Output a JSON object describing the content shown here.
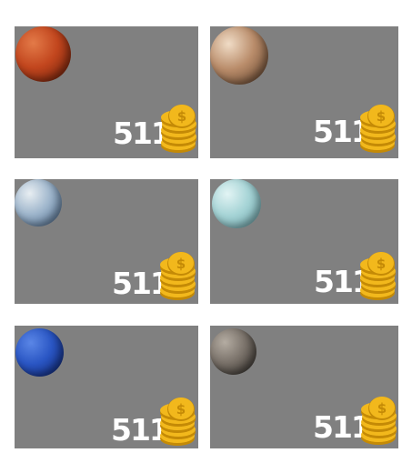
{
  "cards": [
    {
      "planet": "mars-icon",
      "price": "511",
      "colors": {
        "base": "#c2461e",
        "light": "#e37a48",
        "dark": "#6a1e0a"
      }
    },
    {
      "planet": "jupiter-icon",
      "price": "511",
      "colors": {
        "base": "#b98c6a",
        "light": "#f0dcc6",
        "dark": "#5a3d28"
      }
    },
    {
      "planet": "venus-icon",
      "price": "511",
      "colors": {
        "base": "#9fb6cc",
        "light": "#e8eef2",
        "dark": "#4a6a8e"
      }
    },
    {
      "planet": "uranus-icon",
      "price": "511",
      "colors": {
        "base": "#a6d4d6",
        "light": "#e2f4f4",
        "dark": "#6aa4aa"
      }
    },
    {
      "planet": "neptune-icon",
      "price": "511",
      "colors": {
        "base": "#2a56c4",
        "light": "#5a86e6",
        "dark": "#0e2470"
      }
    },
    {
      "planet": "mercury-icon",
      "price": "511",
      "colors": {
        "base": "#7a726a",
        "light": "#b4aca2",
        "dark": "#2e2a26"
      }
    }
  ],
  "colors": {
    "card_bg": "#808080",
    "coin": "#f2b81c",
    "coin_dark": "#c48a06",
    "price_text": "#ffffff"
  }
}
